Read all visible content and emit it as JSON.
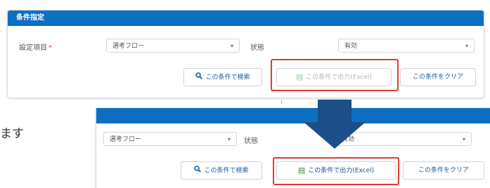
{
  "top_panel": {
    "header": "条件指定",
    "field_label": "設定項目",
    "required_mark": "*",
    "select1_value": "選考フロー",
    "status_label": "状態",
    "select2_value": "有効",
    "btn_search": "この条件で検索",
    "btn_export": "この条件で出力(Excel)",
    "btn_clear": "この条件をクリア",
    "export_state": "disabled"
  },
  "side_text": "ます",
  "bottom_panel": {
    "select1_value": "選考フロー",
    "status_label": "状態",
    "select2_value": "有効",
    "btn_search": "この条件で検索",
    "btn_export": "この条件で出力(Excel)",
    "btn_clear": "この条件をクリア",
    "export_state": "enabled"
  },
  "colors": {
    "header": "#0d6fc2",
    "highlight": "#e53935",
    "arrow": "#1c4e8a",
    "excel_icon": "#2e8b3a"
  },
  "icons": [
    "search-icon",
    "excel-icon",
    "caret-down-icon",
    "down-arrow-icon"
  ]
}
